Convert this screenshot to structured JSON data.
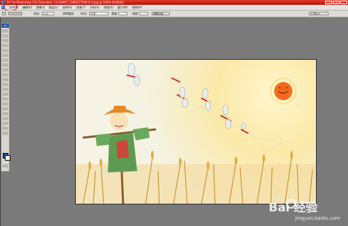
{
  "app": {
    "title": "Adobe Photoshop CS3 Extended - [1139957_1280227598-0_0.jpg @ 100% (RGB/8)]",
    "logo": "Ps",
    "window_buttons": [
      "–",
      "□",
      "×"
    ]
  },
  "menubar": {
    "logo": "Ps",
    "items": [
      "文件(F)",
      "编辑(E)",
      "图像(I)",
      "图层(L)",
      "选择(S)",
      "滤镜(T)",
      "分析(A)",
      "视图(V)",
      "窗口(W)",
      "帮助(H)"
    ]
  },
  "options": {
    "feather_label": "羽化:",
    "feather_value": "0 px",
    "antialias_label": "消除锯齿",
    "style_label": "样式:",
    "style_value": "正常",
    "width_label": "宽度:",
    "height_label": "高度:",
    "refine_label": "调整边缘...",
    "workspace_value": "工作区 ▾"
  },
  "toolbox": {
    "header": "Ps"
  },
  "watermark": {
    "main": "Bai  经验",
    "sub": "jingyan.baidu.com"
  },
  "colors": {
    "titlebar": "#c41f12",
    "foreground_swatch": "#1f57c3",
    "background_swatch": "#ffffff",
    "circle_annotation": "#e01010"
  },
  "icons": [
    "photoshop-logo-icon",
    "minimize-icon",
    "maximize-icon",
    "close-icon",
    "marquee-tool-icon"
  ]
}
